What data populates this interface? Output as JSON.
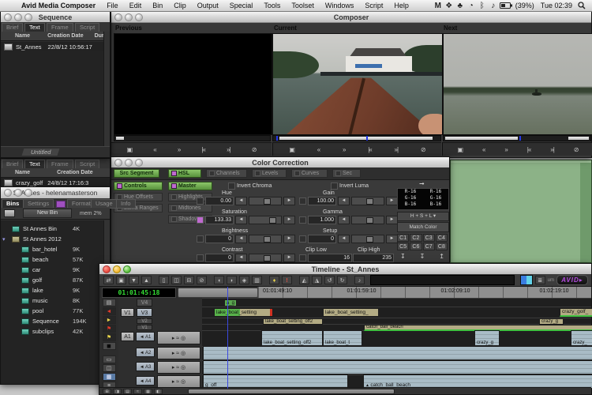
{
  "menu_bar": {
    "apple": "",
    "app_name": "Avid Media Composer",
    "items": [
      "File",
      "Edit",
      "Bin",
      "Clip",
      "Output",
      "Special",
      "Tools",
      "Toolset",
      "Windows",
      "Script",
      "Help"
    ],
    "status": {
      "icons": [
        {
          "name": "script-menu-icon",
          "glyph": "M"
        },
        {
          "name": "color-profile-icon",
          "glyph": "❖"
        },
        {
          "name": "app-extra-icon",
          "glyph": "♣"
        },
        {
          "name": "time-machine-icon",
          "glyph": "◔"
        },
        {
          "name": "bluetooth-icon",
          "glyph": "ᛒ"
        },
        {
          "name": "volume-icon",
          "glyph": "♪"
        }
      ],
      "battery": "(39%)",
      "clock": "Tue 02:39"
    }
  },
  "sequence_window": {
    "title": "Sequence",
    "tabs": [
      "Brief",
      "Text",
      "Frame",
      "Script"
    ],
    "columns": [
      "Name",
      "Creation Date",
      "Dur"
    ],
    "rows": [
      {
        "name": "St_Annes",
        "creation_date": "22/8/12 10:56:17"
      }
    ],
    "bottom_tab": "Untitled"
  },
  "bin_back_window": {
    "tabs": [
      "Brief",
      "Text",
      "Frame",
      "Script"
    ],
    "columns": [
      "Name",
      "Creation Date"
    ],
    "rows": [
      {
        "name": "crazy_golf",
        "creation_date": "24/8/12 17:16:3"
      }
    ]
  },
  "project_window": {
    "title": "St Annes - helenamasterson",
    "tabs": [
      "Bins",
      "Settings",
      "Format",
      "Usage",
      "Info"
    ],
    "new_bin_label": "New Bin",
    "mem_label": "mem 2%",
    "items": [
      {
        "name": "St Annes Bin",
        "size": "4K"
      },
      {
        "name": "St Annes 2012",
        "size": ""
      },
      {
        "name": "bar_hotel",
        "size": "9K"
      },
      {
        "name": "beach",
        "size": "57K"
      },
      {
        "name": "car",
        "size": "9K"
      },
      {
        "name": "golf",
        "size": "87K"
      },
      {
        "name": "lake",
        "size": "9K"
      },
      {
        "name": "music",
        "size": "8K"
      },
      {
        "name": "pool",
        "size": "77K"
      },
      {
        "name": "Sequence",
        "size": "194K"
      },
      {
        "name": "subclips",
        "size": "42K"
      }
    ]
  },
  "composer": {
    "title": "Composer",
    "monitors": [
      "Previous",
      "Current",
      "Next"
    ],
    "transport": [
      {
        "name": "grid-button",
        "glyph": "▣"
      },
      {
        "name": "rewind-button",
        "glyph": "«"
      },
      {
        "name": "fast-forward-button",
        "glyph": "»"
      },
      {
        "name": "go-previous-event-button",
        "glyph": "|«"
      },
      {
        "name": "go-next-event-button",
        "glyph": "»|"
      },
      {
        "name": "stop-button",
        "glyph": "⊘"
      }
    ]
  },
  "color_correction": {
    "title": "Color Correction",
    "src_tab": "Src Segment",
    "tabs": [
      "HSL",
      "Channels",
      "Levels",
      "Curves",
      "Sec"
    ],
    "side_tabs": [
      "Controls",
      "Hue Offsets",
      "Luma Ranges"
    ],
    "range_tabs": [
      "Master",
      "Highlights",
      "Midtones",
      "Shadows"
    ],
    "invert_chroma": "Invert Chroma",
    "invert_luma": "Invert Luma",
    "sliders_left": [
      {
        "label": "Hue",
        "value": "0.00"
      },
      {
        "label": "Saturation",
        "value": "133.33"
      },
      {
        "label": "Brightness",
        "value": "0"
      },
      {
        "label": "Contrast",
        "value": "0"
      }
    ],
    "sliders_right": [
      {
        "label": "Gain",
        "value": "100.00"
      },
      {
        "label": "Gamma",
        "value": "1.000"
      },
      {
        "label": "Setup",
        "value": "0"
      }
    ],
    "clip_low": {
      "label": "Clip Low",
      "value": "16"
    },
    "clip_high": {
      "label": "Clip High",
      "value": "235"
    },
    "rgb_left": [
      "R-16",
      "G-16",
      "B-16"
    ],
    "rgb_right": [
      "R-16",
      "G-16",
      "B-16"
    ],
    "mode_button": "H + S + L",
    "match_button": "Match Color",
    "corr_buttons": [
      "C1",
      "C2",
      "C3",
      "C4",
      "C5",
      "C6",
      "C7",
      "C8"
    ]
  },
  "timeline": {
    "title": "Timeline - St_Annes",
    "timecode": "01:01:45:18",
    "ruler": [
      "01:01:49:10",
      "01:01:59:10",
      "01:02:09:10",
      "01:02:19:10"
    ],
    "right_label": "um",
    "brand": "AVID",
    "tracks": {
      "v4": "V4",
      "v3": "V3",
      "v2": "V2",
      "v1": "V1",
      "src_v": "V1",
      "src_a": "A1",
      "rec_a1": "◄ A1",
      "rec_a2": "◄ A2",
      "rec_a3": "◄ A3",
      "rec_a4": "◄ A4"
    },
    "clips": {
      "v4_1": "a_g",
      "v3_1": "lake_boat_setting",
      "v3_2": "lake_boat_setting_",
      "v3_3": "crazy_golf_",
      "v2_1": "lake_boat_setting_off2",
      "v2_2": "crazy_g",
      "v1_1": "catch_ball_beach",
      "a1_1": "lake_boat_setting_off2",
      "a1_2": "lake_boat_t",
      "a1_3": "crazy_g",
      "a1_4": "crazy_",
      "a4_1": "g_off",
      "a4_2": "catch_ball_beach"
    },
    "toolbar_icons": [
      {
        "name": "toggle-source-record-icon",
        "glyph": "⇄"
      },
      {
        "name": "focus-icon",
        "glyph": "▣"
      },
      {
        "name": "collapse-icon",
        "glyph": "▼"
      },
      {
        "name": "expand-icon",
        "glyph": "▲"
      },
      {
        "name": "video-monitor-icon",
        "glyph": "▯"
      },
      {
        "name": "effect-mode-icon",
        "glyph": "◫"
      },
      {
        "name": "trim-mode-icon",
        "glyph": "⊟"
      },
      {
        "name": "render-icon",
        "glyph": "⊘"
      },
      {
        "name": "play-reverse-icon",
        "glyph": "◖"
      },
      {
        "name": "play-forward-icon",
        "glyph": "◗"
      },
      {
        "name": "add-edit-icon",
        "glyph": "◈"
      },
      {
        "name": "splice-icon",
        "glyph": "▥"
      },
      {
        "name": "capture-icon",
        "glyph": "♦"
      },
      {
        "name": "alert-icon",
        "glyph": "!"
      },
      {
        "name": "keyframe-left-icon",
        "glyph": "◭"
      },
      {
        "name": "keyframe-right-icon",
        "glyph": "◮"
      },
      {
        "name": "undo-icon",
        "glyph": "↺"
      },
      {
        "name": "redo-icon",
        "glyph": "↻"
      },
      {
        "name": "speaker-icon",
        "glyph": "♪"
      }
    ],
    "left_icons": [
      {
        "name": "timeline-fast-menu-icon",
        "glyph": "▤",
        "color": "#cccccc"
      },
      {
        "name": "segment-overwrite-icon",
        "glyph": "◄",
        "color": "#e03a2a"
      },
      {
        "name": "segment-splice-icon",
        "glyph": "►",
        "color": "#e8d44a"
      },
      {
        "name": "locator-red-icon",
        "glyph": "⚑",
        "color": "#e03a2a"
      },
      {
        "name": "locator-yellow-icon",
        "glyph": "⚑",
        "color": "#e8d44a"
      },
      {
        "name": "motion-effect-icon",
        "glyph": "◼",
        "color": "#101010"
      },
      {
        "name": "clip-view-icon",
        "glyph": "▭",
        "color": "#bbbbbb"
      },
      {
        "name": "track-view-icon",
        "glyph": "◫",
        "color": "#bbbbbb"
      },
      {
        "name": "timeline-view-icon",
        "glyph": "▦",
        "color": "#e8f0ff"
      },
      {
        "name": "list-view-icon",
        "glyph": "≡",
        "color": "#bbbbbb"
      }
    ],
    "bottom_icons": [
      {
        "name": "bottom-tool-1-icon",
        "glyph": "⊞"
      },
      {
        "name": "bottom-tool-2-icon",
        "glyph": "◨"
      },
      {
        "name": "bottom-tool-3-icon",
        "glyph": "▤"
      },
      {
        "name": "bottom-tool-4-icon",
        "glyph": "≈"
      },
      {
        "name": "bottom-tool-5-icon",
        "glyph": "▦"
      },
      {
        "name": "bottom-tool-6-icon",
        "glyph": "◧"
      }
    ],
    "audio_tool_glyphs": "▸ ≈ ◎"
  },
  "colors": {
    "tab_green": "#5f9e3f",
    "enable_purple": "#c06ad0",
    "timecode_green": "#35e035",
    "video_clip_tan": "#b3ab84",
    "audio_clip_blue": "#a9bcc6",
    "avid_purple": "#8a2be2",
    "green_bin_window": "#8cb287"
  }
}
